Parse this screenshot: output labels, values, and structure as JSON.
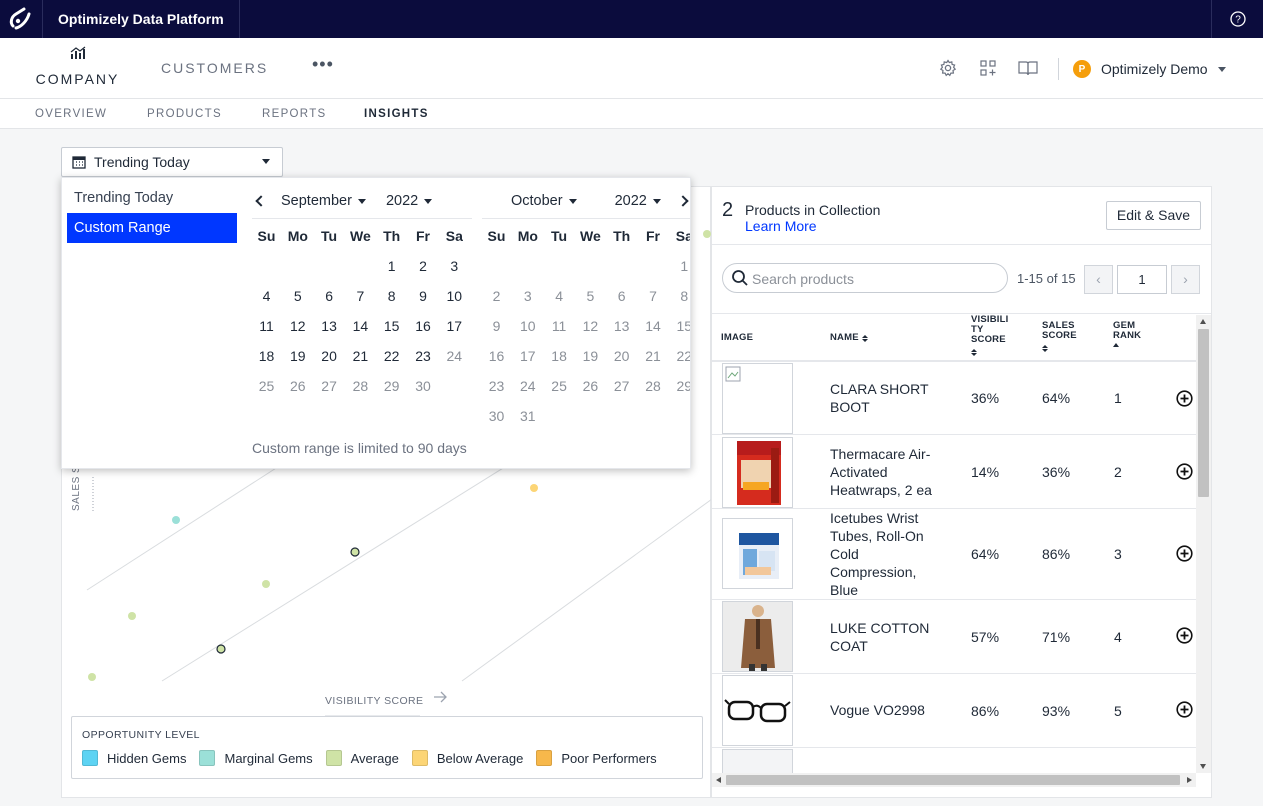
{
  "app": {
    "title": "Optimizely Data Platform"
  },
  "nav": {
    "company_label": "COMPANY",
    "customers_label": "CUSTOMERS",
    "more_label": "•••",
    "user_initial": "P",
    "user_name": "Optimizely Demo"
  },
  "subtabs": [
    "OVERVIEW",
    "PRODUCTS",
    "REPORTS",
    "INSIGHTS"
  ],
  "active_subtab": "INSIGHTS",
  "trend_dropdown": {
    "value": "Trending Today"
  },
  "date_picker": {
    "options": [
      "Trending Today",
      "Custom Range"
    ],
    "selected_option": "Custom Range",
    "left": {
      "month": "September",
      "year": "2022",
      "weekdays": [
        "Su",
        "Mo",
        "Tu",
        "We",
        "Th",
        "Fr",
        "Sa"
      ],
      "first_weekday": 4,
      "days": 30,
      "enabled_until": 23
    },
    "right": {
      "month": "October",
      "year": "2022",
      "weekdays": [
        "Su",
        "Mo",
        "Tu",
        "We",
        "Th",
        "Fr",
        "Sa"
      ],
      "first_weekday": 6,
      "days": 31,
      "enabled_until": 0
    },
    "note": "Custom range is limited to 90 days"
  },
  "chart": {
    "y_axis_label": "SALES S",
    "x_axis_label": "VISIBILITY SCORE",
    "legend_title": "OPPORTUNITY LEVEL",
    "legend": [
      {
        "label": "Hidden Gems",
        "color": "#5dd3f3"
      },
      {
        "label": "Marginal Gems",
        "color": "#9be0d8"
      },
      {
        "label": "Average",
        "color": "#cfe3a6"
      },
      {
        "label": "Below Average",
        "color": "#fcd576"
      },
      {
        "label": "Poor Performers",
        "color": "#f7b84b"
      }
    ]
  },
  "collection": {
    "count": "2",
    "label": "Products in Collection",
    "learn_more": "Learn More",
    "edit_button": "Edit & Save"
  },
  "search": {
    "placeholder": "Search products"
  },
  "pagination": {
    "range_text": "1-15 of 15",
    "page": "1",
    "prev": "‹",
    "next": "›"
  },
  "table": {
    "headers": {
      "image": "IMAGE",
      "name": "NAME",
      "visibility": [
        "VISIBILI",
        "TY",
        "SCORE"
      ],
      "sales": [
        "SALES",
        "SCORE"
      ],
      "gem": [
        "GEM",
        "RANK"
      ]
    },
    "rows": [
      {
        "name": "CLARA SHORT BOOT",
        "visibility": "36%",
        "sales": "64%",
        "gem": "1",
        "image": "broken-image-icon"
      },
      {
        "name": "Thermacare Air-Activated Heatwraps, 2 ea",
        "visibility": "14%",
        "sales": "36%",
        "gem": "2",
        "image": "thermacare-box"
      },
      {
        "name": "Icetubes Wrist Tubes, Roll-On Cold Compression, Blue",
        "visibility": "64%",
        "sales": "86%",
        "gem": "3",
        "image": "icetubes-box"
      },
      {
        "name": "LUKE COTTON COAT",
        "visibility": "57%",
        "sales": "71%",
        "gem": "4",
        "image": "coat-model"
      },
      {
        "name": "Vogue VO2998",
        "visibility": "86%",
        "sales": "93%",
        "gem": "5",
        "image": "eyeglasses"
      }
    ]
  },
  "colors": {
    "topbar": "#0b0c3d",
    "accent": "#0037ff",
    "avatar": "#f59e0b"
  }
}
